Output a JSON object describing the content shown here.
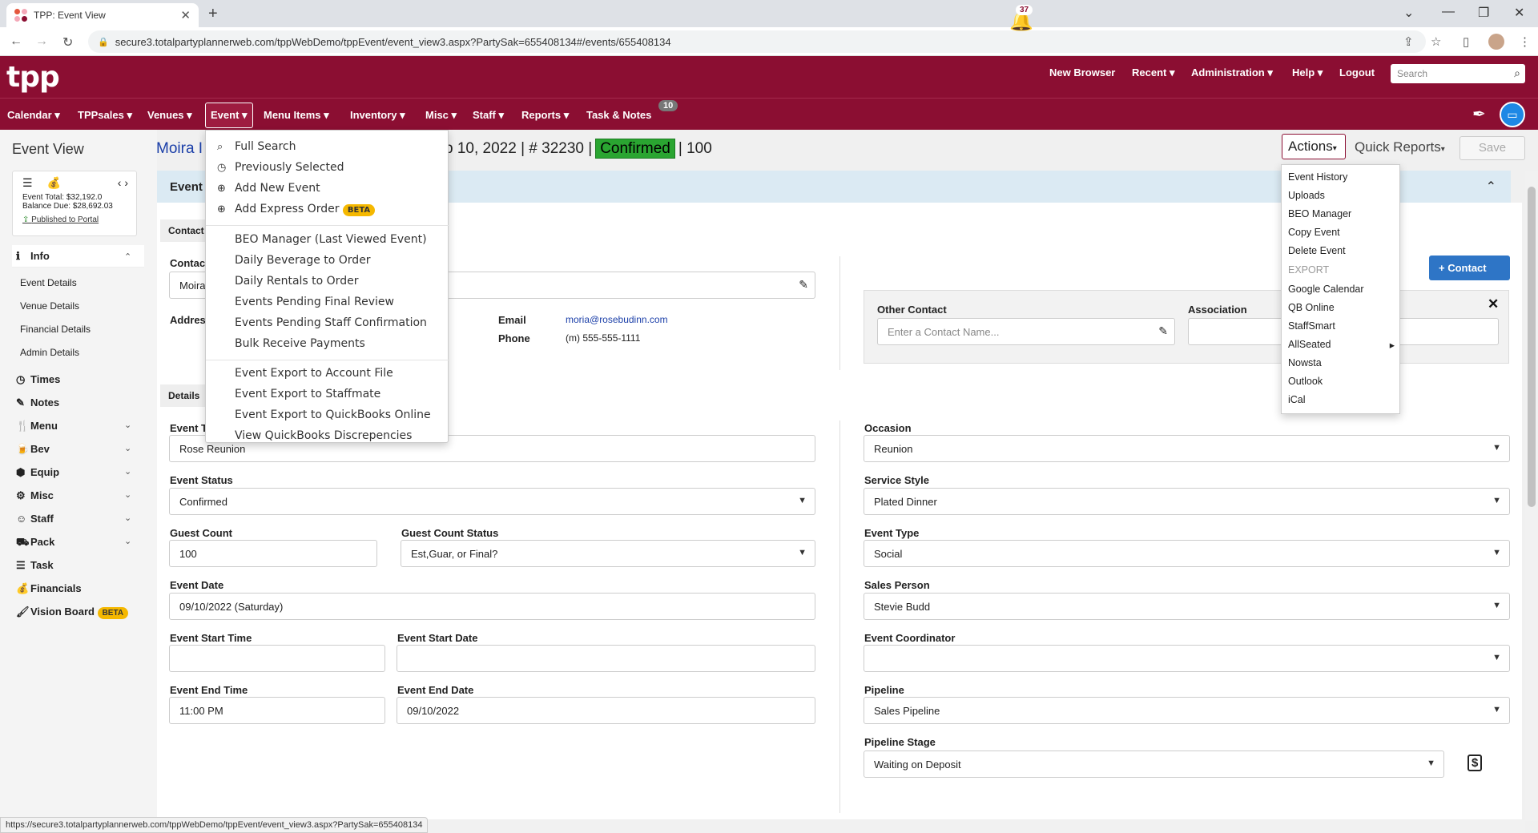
{
  "browser": {
    "tab_title": "TPP: Event View",
    "url": "secure3.totalpartyplannerweb.com/tppWebDemo/tppEvent/event_view3.aspx?PartySak=655408134#/events/655408134",
    "status_url": "https://secure3.totalpartyplannerweb.com/tppWebDemo/tppEvent/event_view3.aspx?PartySak=655408134"
  },
  "header": {
    "logo": "tpp",
    "notification_count": "37",
    "links": [
      "New Browser",
      "Recent",
      "Administration",
      "Help",
      "Logout"
    ],
    "search_placeholder": "Search"
  },
  "menubar": {
    "items": [
      "Calendar",
      "TPPsales",
      "Venues",
      "Event",
      "Menu Items",
      "Inventory",
      "Misc",
      "Staff",
      "Reports",
      "Task & Notes"
    ],
    "task_badge": "10"
  },
  "event_header": {
    "page_title": "Event View",
    "event_name_partial": "Moira I",
    "event_info_partial": "p 10, 2022 | # 32230 |",
    "status": "Confirmed",
    "guest_count": "| 100",
    "actions_label": "Actions",
    "quick_reports_label": "Quick Reports",
    "save_label": "Save"
  },
  "summary": {
    "event_total": "Event Total: $32,192.0",
    "balance_due": "Balance Due: $28,692.03",
    "published": "Published to Portal"
  },
  "sidebar": {
    "info": "Info",
    "sub": [
      "Event Details",
      "Venue Details",
      "Financial Details",
      "Admin Details"
    ],
    "items": [
      "Times",
      "Notes",
      "Menu",
      "Bev",
      "Equip",
      "Misc",
      "Staff",
      "Pack",
      "Task",
      "Financials",
      "Vision Board"
    ],
    "beta": "BETA"
  },
  "event_menu": {
    "group1": [
      "Full Search",
      "Previously Selected",
      "Add New Event",
      "Add Express Order"
    ],
    "beta": "BETA",
    "group2": [
      "BEO Manager (Last Viewed Event)",
      "Daily Beverage to Order",
      "Daily Rentals to Order",
      "Events Pending Final Review",
      "Events Pending Staff Confirmation",
      "Bulk Receive Payments"
    ],
    "group3": [
      "Event Export to Account File",
      "Event Export to Staffmate",
      "Event Export to QuickBooks Online",
      "View QuickBooks Discrepencies"
    ]
  },
  "actions_menu": {
    "items": [
      "Event History",
      "Uploads",
      "BEO Manager",
      "Copy Event",
      "Delete Event",
      "EXPORT",
      "Google Calendar",
      "QB Online",
      "StaffSmart",
      "AllSeated",
      "Nowsta",
      "Outlook",
      "iCal"
    ]
  },
  "main": {
    "band_title": "Event",
    "contact_section": "Contact",
    "details_section": "Details",
    "contact_label": "Contac",
    "contact_value": "Moira",
    "address_label": "Addres",
    "email_label": "Email",
    "email_value": "moria@rosebudinn.com",
    "phone_label": "Phone",
    "phone_value": "(m) 555-555-1111",
    "contact_button": "Contact",
    "other_contact_label": "Other Contact",
    "other_contact_placeholder": "Enter a Contact Name...",
    "association_label": "Association"
  },
  "fields": {
    "event_title_label": "Event T",
    "event_title": "Rose Reunion",
    "event_status_label": "Event Status",
    "event_status": "Confirmed",
    "guest_count_label": "Guest Count",
    "guest_count": "100",
    "guest_count_status_label": "Guest Count Status",
    "guest_count_status": "Est,Guar, or Final?",
    "event_date_label": "Event Date",
    "event_date": "09/10/2022  (Saturday)",
    "start_time_label": "Event Start Time",
    "start_time": "",
    "start_date_label": "Event Start Date",
    "start_date": "",
    "end_time_label": "Event End Time",
    "end_time": "11:00 PM",
    "end_date_label": "Event End Date",
    "end_date": "09/10/2022",
    "occasion_label": "Occasion",
    "occasion": "Reunion",
    "service_style_label": "Service Style",
    "service_style": "Plated Dinner",
    "event_type_label": "Event Type",
    "event_type": "Social",
    "sales_person_label": "Sales Person",
    "sales_person": "Stevie Budd",
    "coordinator_label": "Event Coordinator",
    "coordinator": "",
    "pipeline_label": "Pipeline",
    "pipeline": "Sales Pipeline",
    "pipeline_stage_label": "Pipeline Stage",
    "pipeline_stage": "Waiting on Deposit"
  },
  "colors": {
    "brand": "#8b0e32",
    "confirmed": "#2aa531",
    "link": "#1a3ea8",
    "button": "#2e75c6",
    "beta": "#f5b800"
  }
}
